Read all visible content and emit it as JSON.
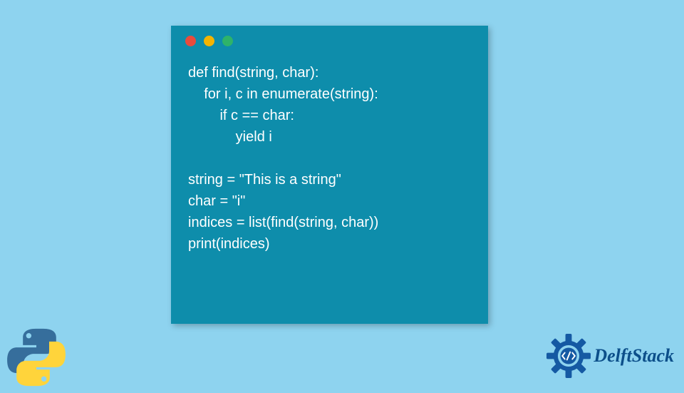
{
  "code": {
    "line1": "def find(string, char):",
    "line2": "    for i, c in enumerate(string):",
    "line3": "        if c == char:",
    "line4": "            yield i",
    "line5": "",
    "line6": "string = \"This is a string\"",
    "line7": "char = \"i\"",
    "line8": "indices = list(find(string, char))",
    "line9": "print(indices)"
  },
  "brand": {
    "name": "DelftStack"
  }
}
